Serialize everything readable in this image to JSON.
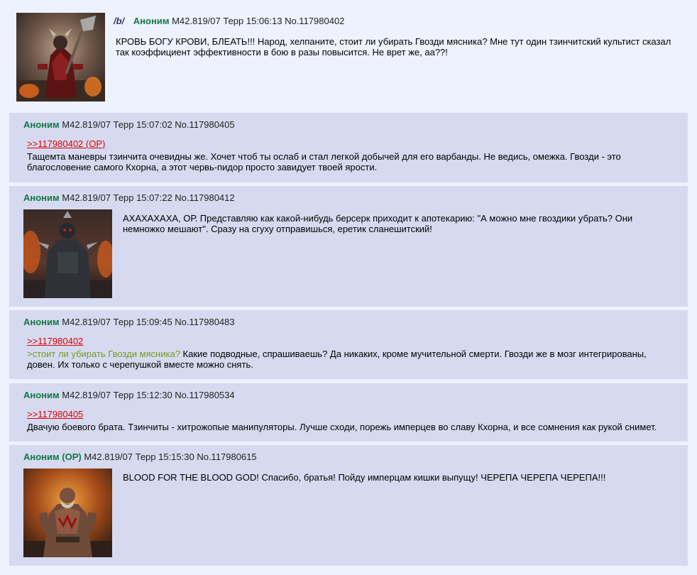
{
  "op": {
    "board": "/b/",
    "name": "Аноним",
    "meta": "М42.819/07 Терр 15:06:13 No.117980402",
    "text": "КРОВЬ БОГУ КРОВИ, БЛЕАТЬ!!! Народ, хелпаните, стоит ли убирать Гвозди мясника? Мне тут один тзинчитский культист сказал так коэффициент эффективности в бою в разы повысится. Не врет же, аа??!"
  },
  "replies": [
    {
      "name": "Аноним",
      "meta": "М42.819/07 Терр 15:07:02 No.117980405",
      "quote": ">>117980402 (OP)",
      "text": "Тащемта маневры тзинчита очевидны же. Хочет чтоб ты ослаб и стал легкой добычей для его варбанды. Не ведись, омежка. Гвозди - это благословение самого Кхорна, а этот червь-пидор просто завидует твоей ярости."
    },
    {
      "name": "Аноним",
      "meta": "М42.819/07 Терр 15:07:22 No.117980412",
      "text": "АХАХАХАХА, ОР. Представляю как какой-нибудь берсерк приходит к апотекарию: \"А можно мне гвоздики убрать? Они немножко мешают\". Сразу на сгуху отправишься, еретик сланешитский!"
    },
    {
      "name": "Аноним",
      "meta": "М42.819/07 Терр 15:09:45 No.117980483",
      "quote": ">>117980402",
      "greentext": ">стоит ли убирать Гвозди мясника?",
      "text": " Какие подводные, спрашиваешь? Да никаких, кроме мучительной смерти. Гвозди же в мозг интегрированы, довен. Их только с черепушкой вместе можно снять."
    },
    {
      "name": "Аноним",
      "meta": "М42.819/07 Терр 15:12:30 No.117980534",
      "quote": ">>117980405",
      "text": "Двачую боевого брата. Тзинчиты - хитрожопые манипуляторы. Лучше сходи, порежь имперцев во славу Кхорна, и все сомнения как рукой снимет."
    },
    {
      "name": "Аноним (OP)",
      "meta": "М42.819/07 Терр 15:15:30 No.117980615",
      "text": "BLOOD FOR THE BLOOD GOD! Спасибо, братья! Пойду имперцам кишки выпущу! ЧЕРЕПА ЧЕРЕПА ЧЕРЕПА!!!"
    }
  ],
  "colors": {
    "page_bg": "#eef2ff",
    "reply_bg": "#d6daf0",
    "name": "#117743",
    "quote_link": "#dd0000",
    "greentext": "#789922"
  },
  "images": [
    "khorne-warrior-axe-thumbnail",
    "armored-berserker-thumbnail",
    "blood-warrior-thumbnail"
  ]
}
